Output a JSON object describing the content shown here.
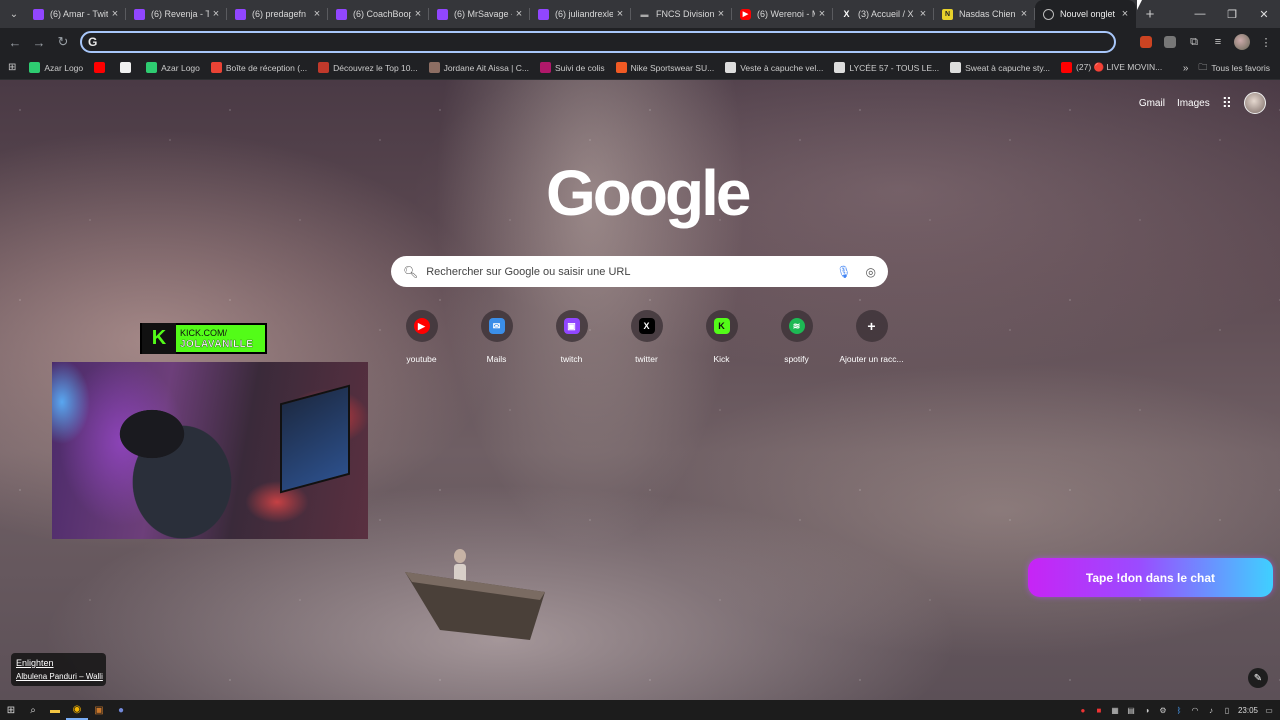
{
  "tabs": [
    {
      "title": "(6) Amar - Twit",
      "favicon": "twitch-icon"
    },
    {
      "title": "(6) Revenja - Tv",
      "favicon": "twitch-icon"
    },
    {
      "title": "(6) predagefn",
      "favicon": "twitch-icon"
    },
    {
      "title": "(6) CoachBoop",
      "favicon": "twitch-icon"
    },
    {
      "title": "(6) MrSavage -",
      "favicon": "twitch-icon"
    },
    {
      "title": "(6) juliandrexle",
      "favicon": "twitch-icon"
    },
    {
      "title": "FNCS Division",
      "favicon": "fncs-icon"
    },
    {
      "title": "(6) Werenoi - M",
      "favicon": "youtube-icon"
    },
    {
      "title": "(3) Accueil / X",
      "favicon": "x-icon"
    },
    {
      "title": "Nasdas Chien",
      "favicon": "nasdas-icon"
    },
    {
      "title": "Nouvel onglet",
      "favicon": "chrome-icon"
    }
  ],
  "tab_close_glyph": "×",
  "new_tab_glyph": "+",
  "omnibox": {
    "value": "",
    "prefix": "G"
  },
  "bookmarks": [
    {
      "label": "Azar Logo",
      "icon": "azar-icon",
      "color": "#2ecc71"
    },
    {
      "label": "",
      "icon": "youtube-icon",
      "color": "#ff0000"
    },
    {
      "label": "",
      "icon": "page-icon",
      "color": "#f0f0f0"
    },
    {
      "label": "Azar Logo",
      "icon": "azar-icon",
      "color": "#2ecc71"
    },
    {
      "label": "Boîte de réception (...",
      "icon": "gmail-icon",
      "color": "#ea4335"
    },
    {
      "label": "Découvrez le Top 10...",
      "icon": "tl-icon",
      "color": "#c0392b"
    },
    {
      "label": "Jordane Ait Aissa | C...",
      "icon": "person-icon",
      "color": "#8d6e63"
    },
    {
      "label": "Suivi de colis",
      "icon": "parcel-icon",
      "color": "#b0186a"
    },
    {
      "label": "Nike Sportswear SU...",
      "icon": "nike-icon",
      "color": "#f15a24"
    },
    {
      "label": "Veste à capuche vel...",
      "icon": "shop-icon",
      "color": "#dddddd"
    },
    {
      "label": "LYCÉE 57 - TOUS LE...",
      "icon": "school-icon",
      "color": "#dddddd"
    },
    {
      "label": "Sweat à capuche sty...",
      "icon": "shop-icon",
      "color": "#dddddd"
    },
    {
      "label": "(27) 🔴 LIVE MOVIN...",
      "icon": "youtube-icon",
      "color": "#ff0000"
    }
  ],
  "bookmarks_all_label": "Tous les favoris",
  "google": {
    "gmail_label": "Gmail",
    "images_label": "Images",
    "logo_text": "Google",
    "search_placeholder": "Rechercher sur Google ou saisir une URL"
  },
  "shortcuts": [
    {
      "label": "youtube",
      "icon": "youtube-icon",
      "color": "#ff0000",
      "glyph": "▶"
    },
    {
      "label": "Mails",
      "icon": "mail-icon",
      "color": "#3b8ee8",
      "glyph": "✉"
    },
    {
      "label": "twitch",
      "icon": "twitch-icon",
      "color": "#9146ff",
      "glyph": "▣"
    },
    {
      "label": "twitter",
      "icon": "x-icon",
      "color": "#000000",
      "glyph": "X"
    },
    {
      "label": "Kick",
      "icon": "kick-icon",
      "color": "#53fc18",
      "glyph": "K"
    },
    {
      "label": "spotify",
      "icon": "spotify-icon",
      "color": "#1db954",
      "glyph": "≋"
    },
    {
      "label": "Ajouter un racc...",
      "icon": "plus-icon",
      "color": "#00000000",
      "glyph": "+"
    }
  ],
  "kick_overlay": {
    "k": "K",
    "url": "KICK.COM/",
    "name": "JOLAVANILLE"
  },
  "now_playing": {
    "title": "Enlighten",
    "artist": "Albulena Panduri – Walli"
  },
  "donate_button": "Tape !don dans le chat",
  "taskbar": {
    "clock": "23:05"
  }
}
